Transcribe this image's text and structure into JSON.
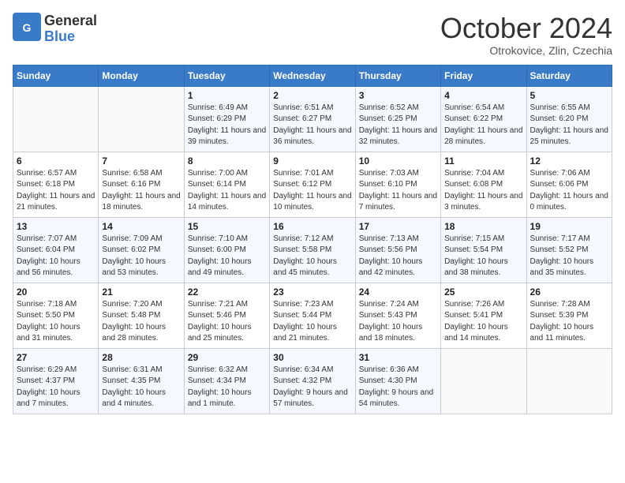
{
  "header": {
    "logo_general": "General",
    "logo_blue": "Blue",
    "title": "October 2024",
    "location": "Otrokovice, Zlin, Czechia"
  },
  "days_of_week": [
    "Sunday",
    "Monday",
    "Tuesday",
    "Wednesday",
    "Thursday",
    "Friday",
    "Saturday"
  ],
  "weeks": [
    [
      {
        "day": "",
        "info": ""
      },
      {
        "day": "",
        "info": ""
      },
      {
        "day": "1",
        "info": "Sunrise: 6:49 AM\nSunset: 6:29 PM\nDaylight: 11 hours and 39 minutes."
      },
      {
        "day": "2",
        "info": "Sunrise: 6:51 AM\nSunset: 6:27 PM\nDaylight: 11 hours and 36 minutes."
      },
      {
        "day": "3",
        "info": "Sunrise: 6:52 AM\nSunset: 6:25 PM\nDaylight: 11 hours and 32 minutes."
      },
      {
        "day": "4",
        "info": "Sunrise: 6:54 AM\nSunset: 6:22 PM\nDaylight: 11 hours and 28 minutes."
      },
      {
        "day": "5",
        "info": "Sunrise: 6:55 AM\nSunset: 6:20 PM\nDaylight: 11 hours and 25 minutes."
      }
    ],
    [
      {
        "day": "6",
        "info": "Sunrise: 6:57 AM\nSunset: 6:18 PM\nDaylight: 11 hours and 21 minutes."
      },
      {
        "day": "7",
        "info": "Sunrise: 6:58 AM\nSunset: 6:16 PM\nDaylight: 11 hours and 18 minutes."
      },
      {
        "day": "8",
        "info": "Sunrise: 7:00 AM\nSunset: 6:14 PM\nDaylight: 11 hours and 14 minutes."
      },
      {
        "day": "9",
        "info": "Sunrise: 7:01 AM\nSunset: 6:12 PM\nDaylight: 11 hours and 10 minutes."
      },
      {
        "day": "10",
        "info": "Sunrise: 7:03 AM\nSunset: 6:10 PM\nDaylight: 11 hours and 7 minutes."
      },
      {
        "day": "11",
        "info": "Sunrise: 7:04 AM\nSunset: 6:08 PM\nDaylight: 11 hours and 3 minutes."
      },
      {
        "day": "12",
        "info": "Sunrise: 7:06 AM\nSunset: 6:06 PM\nDaylight: 11 hours and 0 minutes."
      }
    ],
    [
      {
        "day": "13",
        "info": "Sunrise: 7:07 AM\nSunset: 6:04 PM\nDaylight: 10 hours and 56 minutes."
      },
      {
        "day": "14",
        "info": "Sunrise: 7:09 AM\nSunset: 6:02 PM\nDaylight: 10 hours and 53 minutes."
      },
      {
        "day": "15",
        "info": "Sunrise: 7:10 AM\nSunset: 6:00 PM\nDaylight: 10 hours and 49 minutes."
      },
      {
        "day": "16",
        "info": "Sunrise: 7:12 AM\nSunset: 5:58 PM\nDaylight: 10 hours and 45 minutes."
      },
      {
        "day": "17",
        "info": "Sunrise: 7:13 AM\nSunset: 5:56 PM\nDaylight: 10 hours and 42 minutes."
      },
      {
        "day": "18",
        "info": "Sunrise: 7:15 AM\nSunset: 5:54 PM\nDaylight: 10 hours and 38 minutes."
      },
      {
        "day": "19",
        "info": "Sunrise: 7:17 AM\nSunset: 5:52 PM\nDaylight: 10 hours and 35 minutes."
      }
    ],
    [
      {
        "day": "20",
        "info": "Sunrise: 7:18 AM\nSunset: 5:50 PM\nDaylight: 10 hours and 31 minutes."
      },
      {
        "day": "21",
        "info": "Sunrise: 7:20 AM\nSunset: 5:48 PM\nDaylight: 10 hours and 28 minutes."
      },
      {
        "day": "22",
        "info": "Sunrise: 7:21 AM\nSunset: 5:46 PM\nDaylight: 10 hours and 25 minutes."
      },
      {
        "day": "23",
        "info": "Sunrise: 7:23 AM\nSunset: 5:44 PM\nDaylight: 10 hours and 21 minutes."
      },
      {
        "day": "24",
        "info": "Sunrise: 7:24 AM\nSunset: 5:43 PM\nDaylight: 10 hours and 18 minutes."
      },
      {
        "day": "25",
        "info": "Sunrise: 7:26 AM\nSunset: 5:41 PM\nDaylight: 10 hours and 14 minutes."
      },
      {
        "day": "26",
        "info": "Sunrise: 7:28 AM\nSunset: 5:39 PM\nDaylight: 10 hours and 11 minutes."
      }
    ],
    [
      {
        "day": "27",
        "info": "Sunrise: 6:29 AM\nSunset: 4:37 PM\nDaylight: 10 hours and 7 minutes."
      },
      {
        "day": "28",
        "info": "Sunrise: 6:31 AM\nSunset: 4:35 PM\nDaylight: 10 hours and 4 minutes."
      },
      {
        "day": "29",
        "info": "Sunrise: 6:32 AM\nSunset: 4:34 PM\nDaylight: 10 hours and 1 minute."
      },
      {
        "day": "30",
        "info": "Sunrise: 6:34 AM\nSunset: 4:32 PM\nDaylight: 9 hours and 57 minutes."
      },
      {
        "day": "31",
        "info": "Sunrise: 6:36 AM\nSunset: 4:30 PM\nDaylight: 9 hours and 54 minutes."
      },
      {
        "day": "",
        "info": ""
      },
      {
        "day": "",
        "info": ""
      }
    ]
  ]
}
